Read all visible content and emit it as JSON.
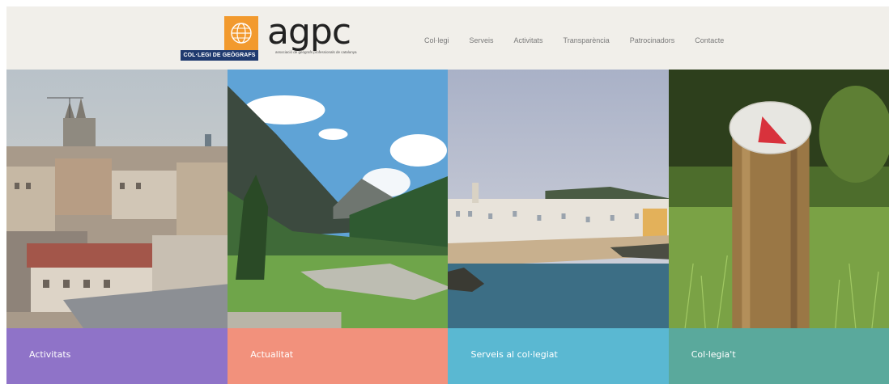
{
  "header": {
    "logo_colegi_text": "COL·LEGI DE GEÒGRAFS",
    "logo_agpc_text": "agpc",
    "logo_agpc_sub": "associació de geògrafs professionals de catalunya"
  },
  "nav": {
    "items": [
      {
        "label": "Col·legi"
      },
      {
        "label": "Serveis"
      },
      {
        "label": "Activitats"
      },
      {
        "label": "Transparència"
      },
      {
        "label": "Patrocinadors"
      },
      {
        "label": "Contacte"
      }
    ]
  },
  "tiles": [
    {
      "label": "Activitats",
      "color": "#8f73c8",
      "image": "barcelona-city-photo"
    },
    {
      "label": "Actualitat",
      "color": "#f2917c",
      "image": "mountain-valley-photo"
    },
    {
      "label": "Serveis al col·legiat",
      "color": "#5ab8d2",
      "image": "coastal-town-photo"
    },
    {
      "label": "Col·legia't",
      "color": "#5aa99c",
      "image": "trail-marker-post-photo"
    }
  ],
  "colors": {
    "header_bg": "#f1efea",
    "logo_orange": "#f29a2e",
    "logo_navy": "#1f3a6f",
    "agpc_accent": "#e2702a",
    "nav_text": "#7a7a7a"
  }
}
